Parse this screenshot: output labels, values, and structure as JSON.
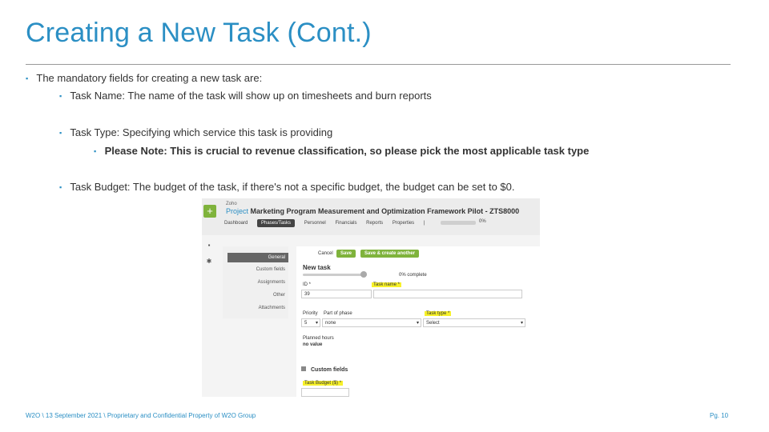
{
  "slide": {
    "title": "Creating a New Task (Cont.)",
    "bullets": {
      "intro": "The mandatory fields for creating a new task are:",
      "task_name": "Task Name: The name of the task will show up on timesheets and burn reports",
      "task_type": "Task Type: Specifying which service this task is providing",
      "note": "Please Note: This is crucial to revenue classification, so please pick the most applicable task type",
      "task_budget": "Task Budget: The budget of the task, if there's not a specific budget, the budget can be set to $0."
    },
    "bullet_glyph": "▪",
    "footer": "W2O \\ 13 September 2021 \\ Proprietary and Confidential Property of W2O Group",
    "page_number": "Pg. 10"
  },
  "app": {
    "add_label": "+",
    "brand": "Zoho",
    "project_label": "Project",
    "project_name": "Marketing Program Measurement and Optimization Framework Pilot - ZTS8000",
    "nav": {
      "dashboard": "Dashboard",
      "phases_tasks": "Phases/Tasks",
      "personnel": "Personnel",
      "financials": "Financials",
      "reports": "Reports",
      "properties": "Properties",
      "separator": "|",
      "percent": "0%"
    },
    "side_menu": {
      "general": "General",
      "custom_fields": "Custom fields",
      "assignments": "Assignments",
      "other": "Other",
      "attachments": "Attachments"
    },
    "form": {
      "cancel": "Cancel",
      "save": "Save",
      "save_create_another": "Save & create another",
      "title": "New task",
      "percent_complete": "0% complete",
      "id_label": "ID *",
      "id_value": "39",
      "task_name_label": "Task name *",
      "priority_label": "Priority",
      "priority_value": "5",
      "part_of_phase_label": "Part of phase",
      "part_of_phase_value": "none",
      "task_type_label": "Task type *",
      "task_type_value": "Select",
      "planned_hours_label": "Planned hours",
      "planned_hours_value": "no value",
      "custom_fields_header": "Custom fields",
      "task_budget_label": "Task Budget ($) *"
    }
  },
  "colors": {
    "accent": "#2b8fc4",
    "green": "#7fb33c",
    "highlight": "#f7f12a"
  }
}
